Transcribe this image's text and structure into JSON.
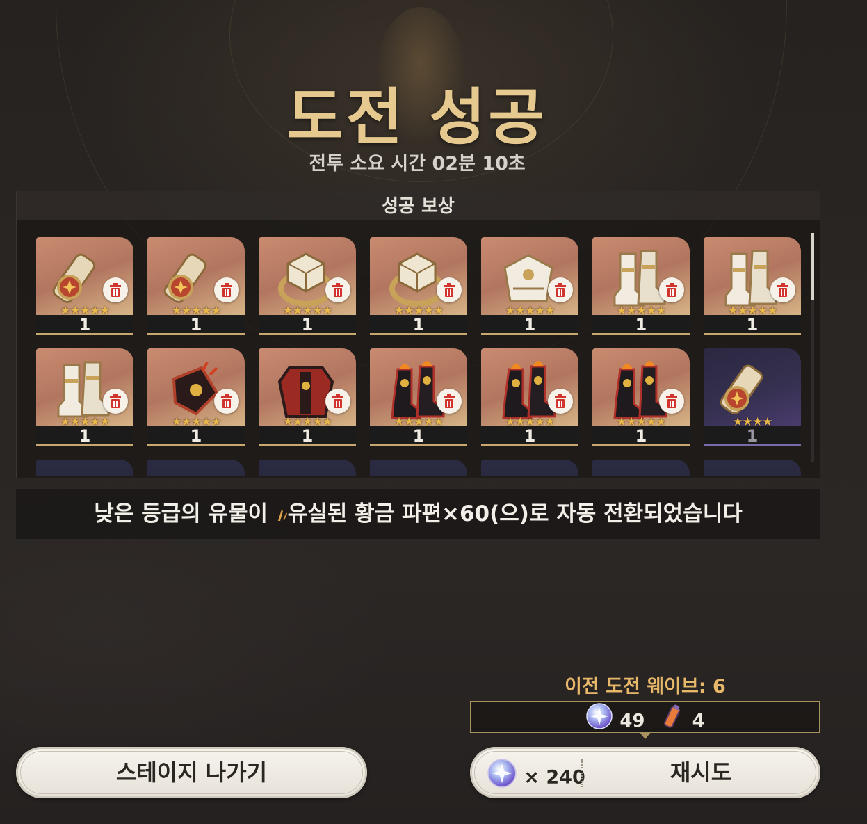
{
  "header": {
    "title": "도전 성공",
    "battle_time": "전투 소요 시간  02분  10초"
  },
  "rewards": {
    "heading": "성공 보상",
    "items": [
      {
        "icon": "spyglass-icon",
        "quantity": "1",
        "stars": 5,
        "rarity": "gold",
        "deletable": true
      },
      {
        "icon": "spyglass-icon",
        "quantity": "1",
        "stars": 5,
        "rarity": "gold",
        "deletable": true
      },
      {
        "icon": "dice-ring-icon",
        "quantity": "1",
        "stars": 5,
        "rarity": "gold",
        "deletable": true
      },
      {
        "icon": "dice-ring-icon",
        "quantity": "1",
        "stars": 5,
        "rarity": "gold",
        "deletable": true
      },
      {
        "icon": "white-gloves-icon",
        "quantity": "1",
        "stars": 5,
        "rarity": "gold",
        "deletable": true
      },
      {
        "icon": "white-boots-icon",
        "quantity": "1",
        "stars": 5,
        "rarity": "gold",
        "deletable": true
      },
      {
        "icon": "white-boots-icon",
        "quantity": "1",
        "stars": 5,
        "rarity": "gold",
        "deletable": true
      },
      {
        "icon": "white-boots-icon",
        "quantity": "1",
        "stars": 5,
        "rarity": "gold",
        "deletable": true
      },
      {
        "icon": "red-gauntlet-icon",
        "quantity": "1",
        "stars": 5,
        "rarity": "gold",
        "deletable": true
      },
      {
        "icon": "red-armor-icon",
        "quantity": "1",
        "stars": 5,
        "rarity": "gold",
        "deletable": true
      },
      {
        "icon": "flame-boots-icon",
        "quantity": "1",
        "stars": 5,
        "rarity": "gold",
        "deletable": true
      },
      {
        "icon": "flame-boots-icon",
        "quantity": "1",
        "stars": 5,
        "rarity": "gold",
        "deletable": true
      },
      {
        "icon": "flame-boots-icon",
        "quantity": "1",
        "stars": 5,
        "rarity": "gold",
        "deletable": true
      },
      {
        "icon": "spyglass-icon",
        "quantity": "1",
        "stars": 4,
        "rarity": "purple",
        "deletable": false
      }
    ]
  },
  "notice": {
    "prefix": "낮은 등급의 유물이 ",
    "item": "유실된 황금 파편×60(으)로 자동 전환되었습니다",
    "icon": "gold-fragment-icon"
  },
  "retry_info": {
    "previous_wave": "이전 도전 웨이브: 6",
    "stamina_count": "49",
    "fuel_count": "4"
  },
  "buttons": {
    "exit_label": "스테이지 나가기",
    "retry_label": "재시도",
    "retry_cost": "× 240"
  },
  "colors": {
    "accent_gold": "#e6c98f",
    "wave_text": "#e8b86a",
    "star": "#e9b74a",
    "card_gold": "#c98b70",
    "card_purple": "#34304e"
  }
}
